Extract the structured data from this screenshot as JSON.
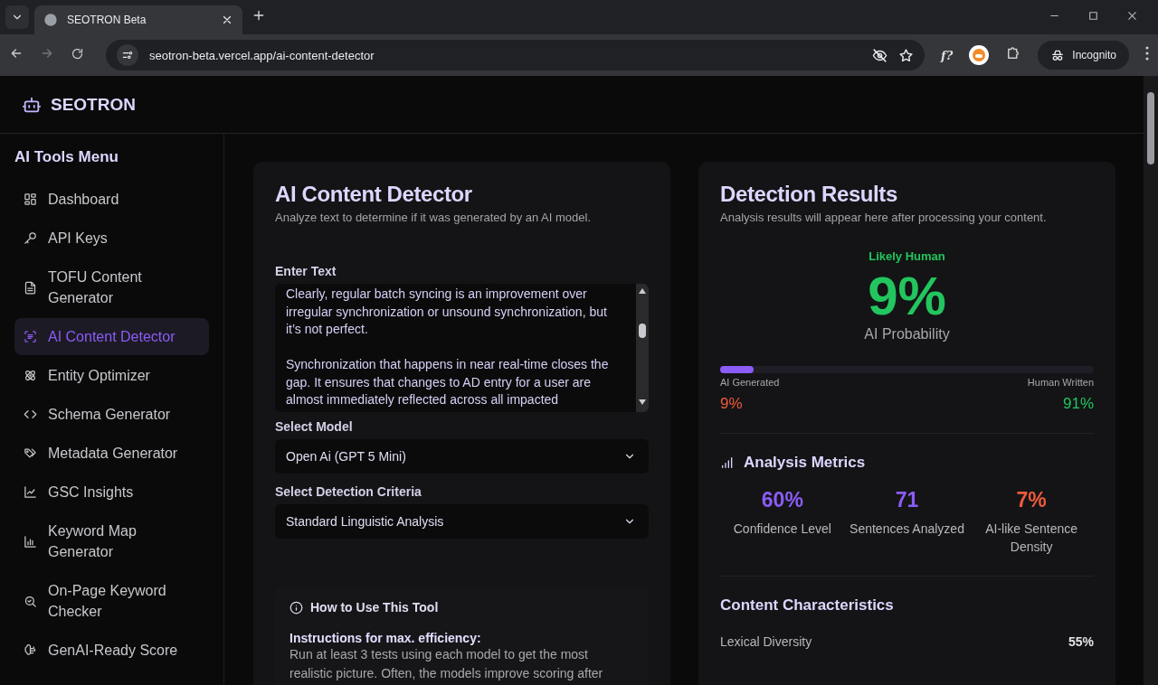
{
  "browser": {
    "tabs": [
      {
        "title": "SEOTRON Beta",
        "selected": true
      }
    ],
    "url": "seotron-beta.vercel.app/ai-content-detector",
    "extension_label": "f?",
    "profile": "Incognito"
  },
  "app": {
    "brand": "SEOTRON"
  },
  "sidebar": {
    "title": "AI Tools Menu",
    "items": [
      {
        "label": "Dashboard",
        "selected": false
      },
      {
        "label": "API Keys",
        "selected": false
      },
      {
        "label": "TOFU Content Generator",
        "selected": false
      },
      {
        "label": "AI Content Detector",
        "selected": true
      },
      {
        "label": "Entity Optimizer",
        "selected": false
      },
      {
        "label": "Schema Generator",
        "selected": false
      },
      {
        "label": "Metadata Generator",
        "selected": false
      },
      {
        "label": "GSC Insights",
        "selected": false
      },
      {
        "label": "Keyword Map Generator",
        "selected": false
      },
      {
        "label": "On-Page Keyword Checker",
        "selected": false
      },
      {
        "label": "GenAI-Ready Score",
        "selected": false
      }
    ]
  },
  "detector": {
    "title": "AI Content Detector",
    "subtitle": "Analyze text to determine if it was generated by an AI model.",
    "text_label": "Enter Text",
    "text_value": "Clearly, regular batch syncing is an improvement over irregular synchronization or unsound synchronization, but it’s not perfect.\n\nSynchronization that happens in near real-time closes the gap. It ensures that changes to AD entry for a user are almost immediately reflected across all impacted",
    "model_label": "Select Model",
    "model_value": "Open Ai (GPT 5 Mini)",
    "criteria_label": "Select Detection Criteria",
    "criteria_value": "Standard Linguistic Analysis",
    "help": {
      "title": "How to Use This Tool",
      "heading": "Instructions for max. efficiency:",
      "text": "Run at least 3 tests using each model to get the most realistic picture. Often, the models improve scoring after"
    }
  },
  "results": {
    "title": "Detection Results",
    "subtitle": "Analysis results will appear here after processing your content.",
    "verdict": "Likely Human",
    "score": "9%",
    "score_label": "AI Probability",
    "level": 0.09,
    "ai_label": "AI Generated",
    "human_label": "Human Written",
    "ai_value": "9%",
    "human_value": "91%",
    "metrics_title": "Analysis Metrics",
    "metrics": [
      {
        "value": "60%",
        "label": "Confidence Level",
        "color": "#8b5cf6"
      },
      {
        "value": "71",
        "label": "Sentences Analyzed",
        "color": "#8b5cf6"
      },
      {
        "value": "7%",
        "label": "AI-like Sentence Density",
        "color": "#ef5a3c"
      }
    ],
    "characteristics_title": "Content Characteristics",
    "characteristics": [
      {
        "label": "Lexical Diversity",
        "value": "55%"
      }
    ]
  }
}
